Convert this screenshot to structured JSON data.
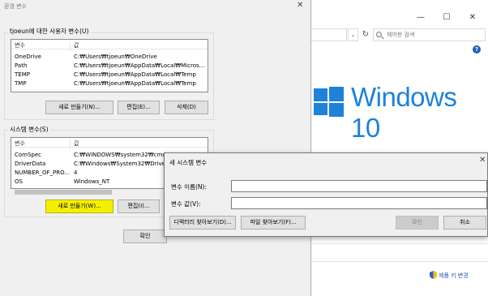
{
  "background_window": {
    "title_buttons": [
      "—",
      "☐",
      "✕"
    ],
    "search_placeholder": "제어판 검색",
    "refresh_glyph": "↻",
    "chevron_glyph": "⌄",
    "help_glyph": "?",
    "brand_text": "Windows 10",
    "footer_link": "제품 키 변경",
    "brand_color": "#1e82d8"
  },
  "env_dialog": {
    "title": "환경 변수",
    "close_glyph": "✕",
    "user_group_label": "tjoeun에 대한 사용자 변수(U)",
    "user_columns": [
      "변수",
      "값"
    ],
    "user_vars": [
      {
        "name": "OneDrive",
        "value": "C:₩Users₩tjoeun₩OneDrive"
      },
      {
        "name": "Path",
        "value": "C:₩Users₩tjoeun₩AppData₩Local₩Micros..."
      },
      {
        "name": "TEMP",
        "value": "C:₩Users₩tjoeun₩AppData₩Local₩Temp"
      },
      {
        "name": "TMP",
        "value": "C:₩Users₩tjoeun₩AppData₩Local₩Temp"
      }
    ],
    "user_buttons": {
      "new": "새로 만들기(N)...",
      "edit": "편집(E)...",
      "delete": "삭제(D)"
    },
    "system_group_label": "시스템 변수(S)",
    "system_columns": [
      "변수",
      "값"
    ],
    "system_vars": [
      {
        "name": "ComSpec",
        "value": "C:₩WINDOWS₩system32₩cmd.exe"
      },
      {
        "name": "DriverData",
        "value": "C:₩Windows₩System32₩Drivers₩"
      },
      {
        "name": "NUMBER_OF_PRO...",
        "value": "4"
      },
      {
        "name": "OS",
        "value": "Windows_NT"
      }
    ],
    "system_buttons": {
      "new": "새로 만들기(W)...",
      "edit": "편집(I)..."
    },
    "ok_label": "확인"
  },
  "new_var_dialog": {
    "title": "새 시스템 변수",
    "close_glyph": "✕",
    "name_label": "변수 이름(N):",
    "name_value": "",
    "value_label": "변수 값(V):",
    "value_value": "",
    "browse_dir_label": "디렉터리 찾아보기(D)...",
    "browse_file_label": "파일 찾아보기(F)...",
    "ok_label": "확인",
    "cancel_label": "취소"
  }
}
